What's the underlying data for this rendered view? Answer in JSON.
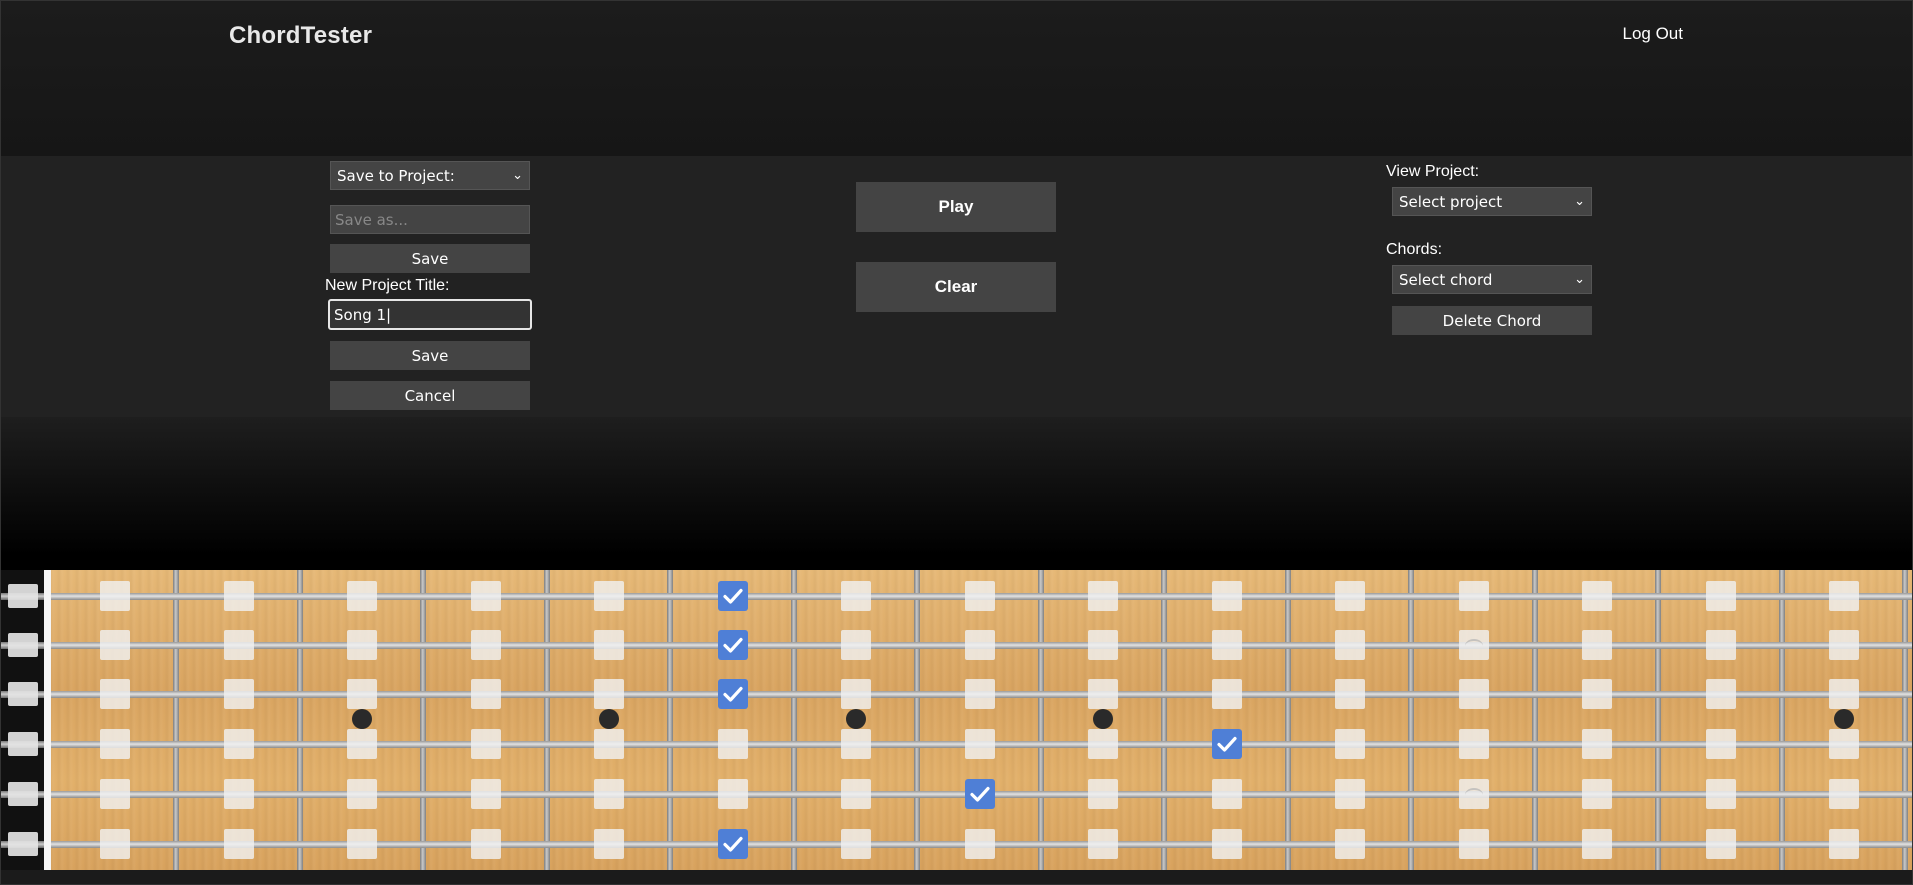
{
  "header": {
    "brand": "ChordTester",
    "logout": "Log Out"
  },
  "save_panel": {
    "project_select": "Save to Project:",
    "save_as_placeholder": "Save as...",
    "save_label": "Save",
    "new_project_label": "New Project Title:",
    "new_project_value": "Song 1",
    "save2_label": "Save",
    "cancel_label": "Cancel"
  },
  "actions": {
    "play": "Play",
    "clear": "Clear"
  },
  "view_panel": {
    "view_label": "View Project:",
    "project_select": "Select project",
    "chords_label": "Chords:",
    "chord_select": "Select chord",
    "delete_label": "Delete Chord"
  },
  "fretboard": {
    "strings": 6,
    "frets": 15,
    "checked": [
      [
        1,
        6
      ],
      [
        2,
        6
      ],
      [
        3,
        6
      ],
      [
        4,
        10
      ],
      [
        5,
        8
      ],
      [
        6,
        6
      ]
    ],
    "ghost": [
      [
        2,
        12
      ],
      [
        5,
        12
      ]
    ],
    "markers": [
      3,
      5,
      7,
      9,
      15
    ],
    "icons": {
      "check": "check-icon"
    },
    "colors": {
      "checked": "#4f7fd6",
      "wood": "#deab66"
    }
  }
}
